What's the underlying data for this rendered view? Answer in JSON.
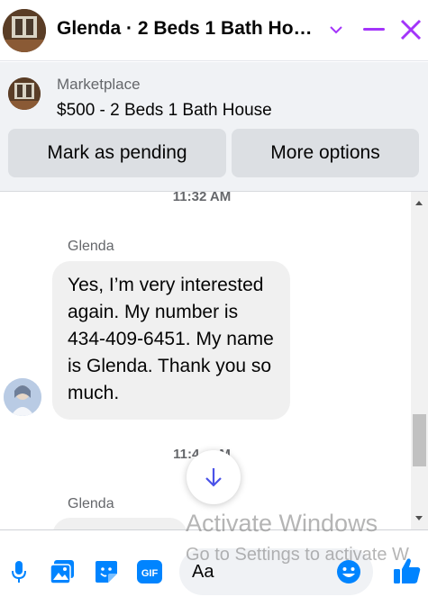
{
  "header": {
    "title": "Glenda · 2 Beds 1 Bath Ho…",
    "icons": [
      "house-avatar",
      "chevron-down-icon",
      "minimize-icon",
      "close-icon"
    ],
    "accent_color": "#a334fa"
  },
  "banner": {
    "source": "Marketplace",
    "listing": "$500 - 2 Beds 1 Bath House",
    "buttons": [
      "Mark as pending",
      "More options"
    ]
  },
  "chat": {
    "timestamp_1": "11:32 AM",
    "message_1": {
      "sender": "Glenda",
      "text": "Yes, I’m very interested again. My number is 434-409-6451. My name is Glenda. Thank you so much."
    },
    "timestamp_2": "11:4",
    "timestamp_2_tail": "M",
    "message_2": {
      "sender": "Glenda"
    },
    "scroll_down_icon": "arrow-down-icon"
  },
  "composer": {
    "placeholder": "Aa",
    "icons": [
      "microphone-icon",
      "image-icon",
      "sticker-icon",
      "gif-icon",
      "emoji-icon",
      "thumbs-up-icon"
    ],
    "gif_label": "GIF",
    "icon_color": "#0084ff"
  },
  "watermark": {
    "line1": "Activate Windows",
    "line2": "Go to Settings to activate W"
  }
}
